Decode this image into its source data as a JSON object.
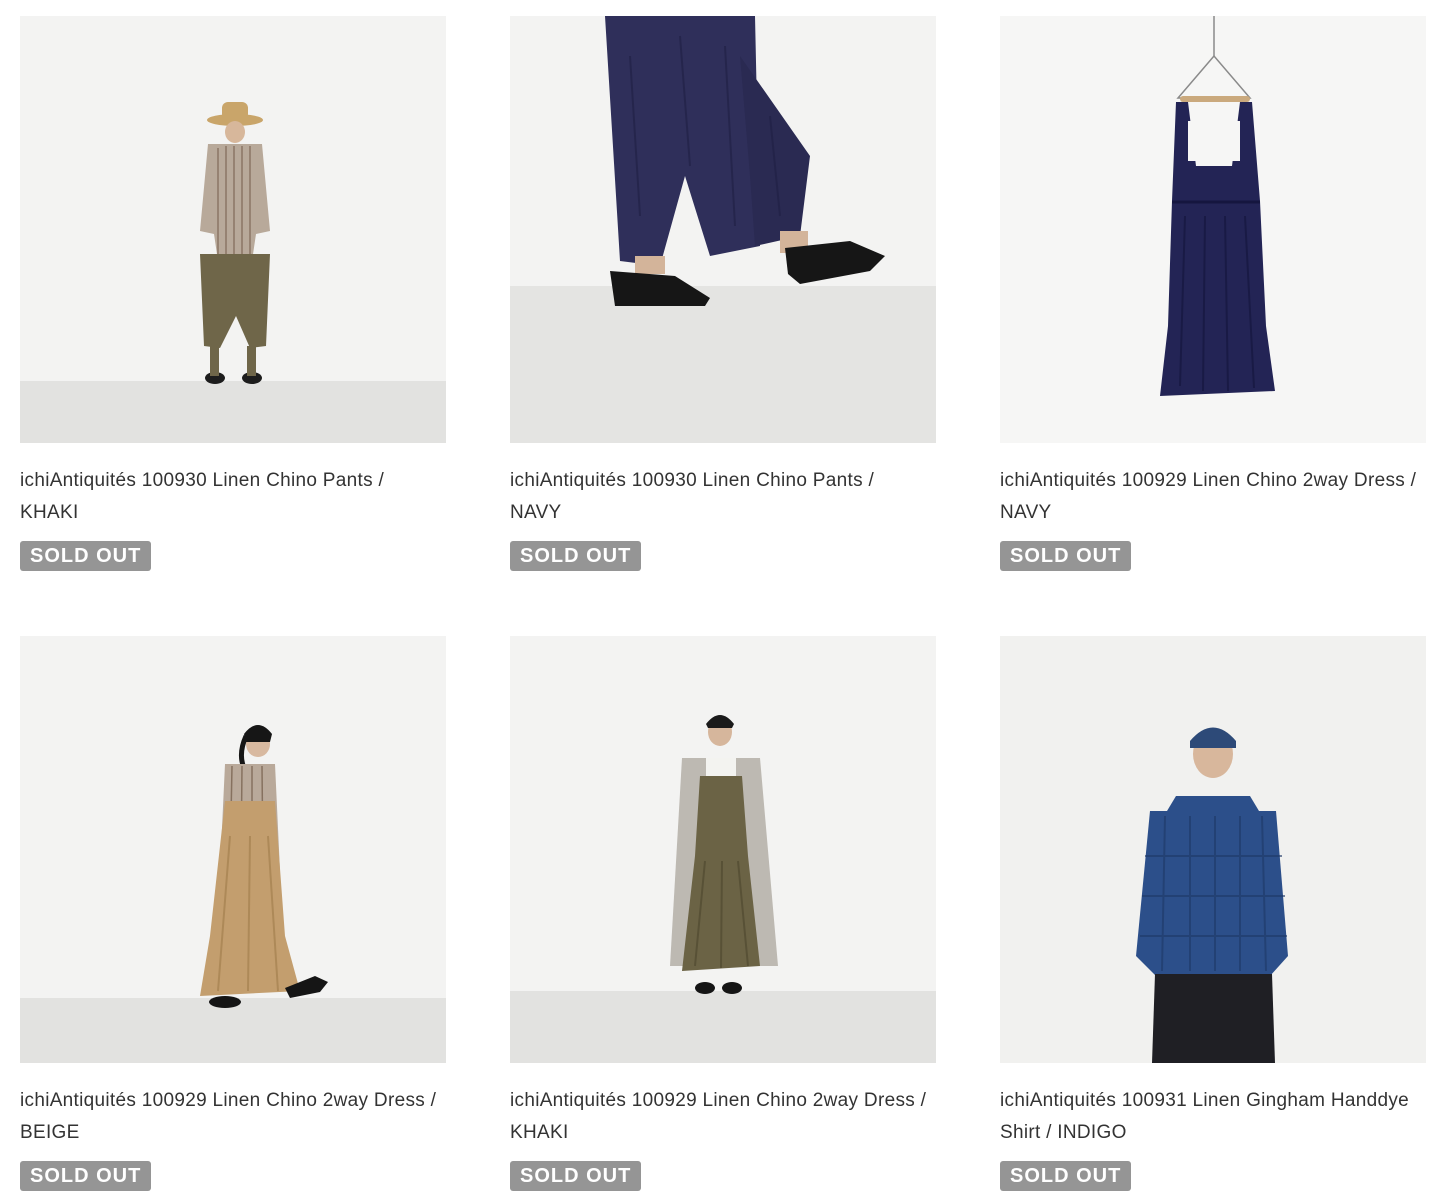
{
  "products": [
    {
      "title": "ichiAntiquités 100930 Linen Chino Pants / KHAKI",
      "badge": "SOLD OUT",
      "photo_icon": "model-khaki-pants-photo"
    },
    {
      "title": "ichiAntiquités 100930 Linen Chino Pants / NAVY",
      "badge": "SOLD OUT",
      "photo_icon": "navy-pants-legs-photo"
    },
    {
      "title": "ichiAntiquités 100929 Linen Chino 2way Dress / NAVY",
      "badge": "SOLD OUT",
      "photo_icon": "navy-dress-on-hanger-photo"
    },
    {
      "title": "ichiAntiquités 100929 Linen Chino 2way Dress / BEIGE",
      "badge": "SOLD OUT",
      "photo_icon": "model-beige-dress-photo"
    },
    {
      "title": "ichiAntiquités 100929 Linen Chino 2way Dress / KHAKI",
      "badge": "SOLD OUT",
      "photo_icon": "model-khaki-dress-photo"
    },
    {
      "title": "ichiAntiquités 100931 Linen Gingham Handdye Shirt / INDIGO",
      "badge": "SOLD OUT",
      "photo_icon": "model-indigo-shirt-photo"
    }
  ],
  "colors": {
    "badge_bg": "#959595",
    "badge_text": "#ffffff",
    "title_text": "#333333",
    "wall": "#f4f4f3",
    "floor": "#e3e3e1"
  }
}
